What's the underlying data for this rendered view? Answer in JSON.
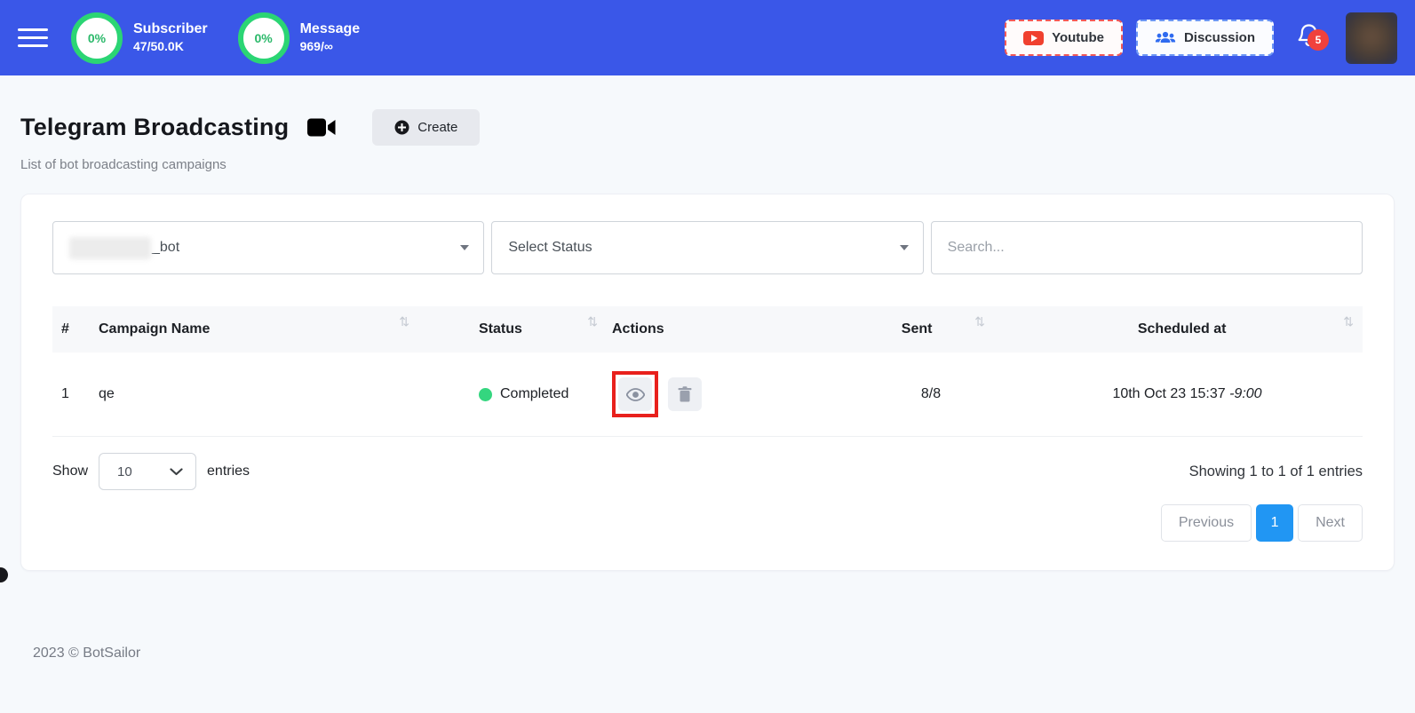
{
  "header": {
    "stats": [
      {
        "percent": "0%",
        "label": "Subscriber",
        "value": "47/50.0K"
      },
      {
        "percent": "0%",
        "label": "Message",
        "value": "969/∞"
      }
    ],
    "youtube_label": "Youtube",
    "discussion_label": "Discussion",
    "notification_count": "5"
  },
  "page": {
    "title": "Telegram Broadcasting",
    "create_label": "Create",
    "subtitle": "List of bot broadcasting campaigns"
  },
  "filters": {
    "bot_select_value": "_bot",
    "status_select_value": "Select Status",
    "search_placeholder": "Search..."
  },
  "table": {
    "columns": [
      "#",
      "Campaign Name",
      "Status",
      "Actions",
      "Sent",
      "Scheduled at"
    ],
    "sort_icon": "⇅",
    "rows": [
      {
        "index": "1",
        "name": "qe",
        "status": "Completed",
        "sent": "8/8",
        "scheduled_at": "10th Oct 23 15:37",
        "timezone": "-9:00"
      }
    ]
  },
  "footer_controls": {
    "show_label": "Show",
    "entries_per_page": "10",
    "entries_label": "entries",
    "showing_text": "Showing 1 to 1 of 1 entries",
    "pagination": {
      "previous": "Previous",
      "current": "1",
      "next": "Next"
    }
  },
  "footer": {
    "copyright": "2023 © BotSailor"
  },
  "colors": {
    "header_blue": "#3a57e8",
    "ring_green": "#2bd574",
    "status_green": "#34d67f",
    "highlight_red": "#e8201c",
    "pagination_active_blue": "#2196f3",
    "badge_red": "#f0413c",
    "youtube_red": "#f0402f",
    "discussion_blue": "#2f6bf0"
  }
}
